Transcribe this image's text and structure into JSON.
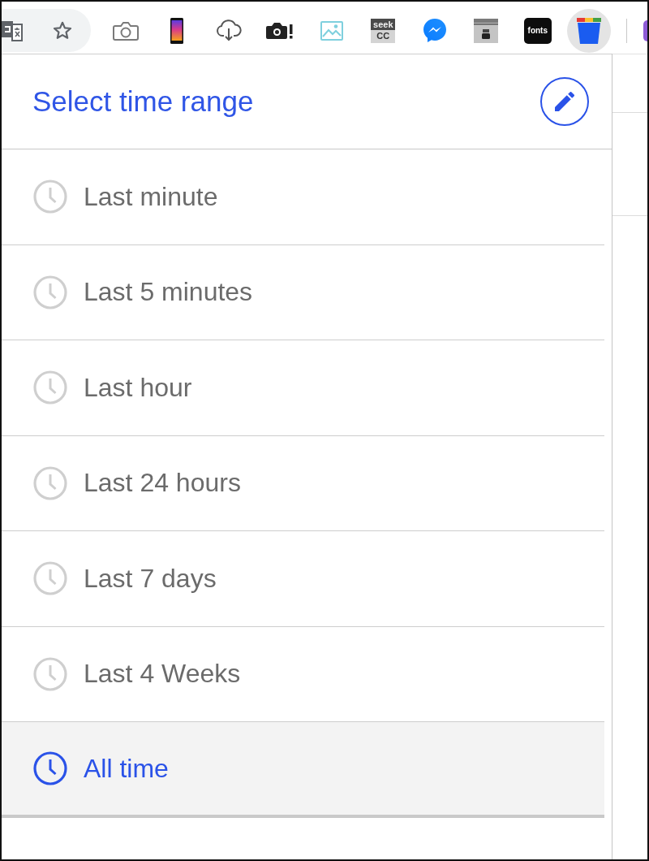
{
  "toolbar": {
    "extensions": [
      {
        "kind": "camera",
        "selected": false
      },
      {
        "kind": "phone",
        "selected": false
      },
      {
        "kind": "cloud",
        "selected": false
      },
      {
        "kind": "capture",
        "selected": false
      },
      {
        "kind": "picture",
        "selected": false
      },
      {
        "kind": "stacked",
        "lines": [
          "seek",
          "CC"
        ],
        "selected": false
      },
      {
        "kind": "bubble",
        "selected": false
      },
      {
        "kind": "folder",
        "selected": false
      },
      {
        "kind": "tile",
        "label": "fonts",
        "selected": false
      },
      {
        "kind": "bucket",
        "selected": true
      }
    ]
  },
  "popup": {
    "title": "Select time range",
    "ranges": [
      {
        "label": "Last minute",
        "selected": false
      },
      {
        "label": "Last 5 minutes",
        "selected": false
      },
      {
        "label": "Last hour",
        "selected": false
      },
      {
        "label": "Last 24 hours",
        "selected": false
      },
      {
        "label": "Last 7 days",
        "selected": false
      },
      {
        "label": "Last 4 Weeks",
        "selected": false
      },
      {
        "label": "All time",
        "selected": true
      }
    ]
  }
}
